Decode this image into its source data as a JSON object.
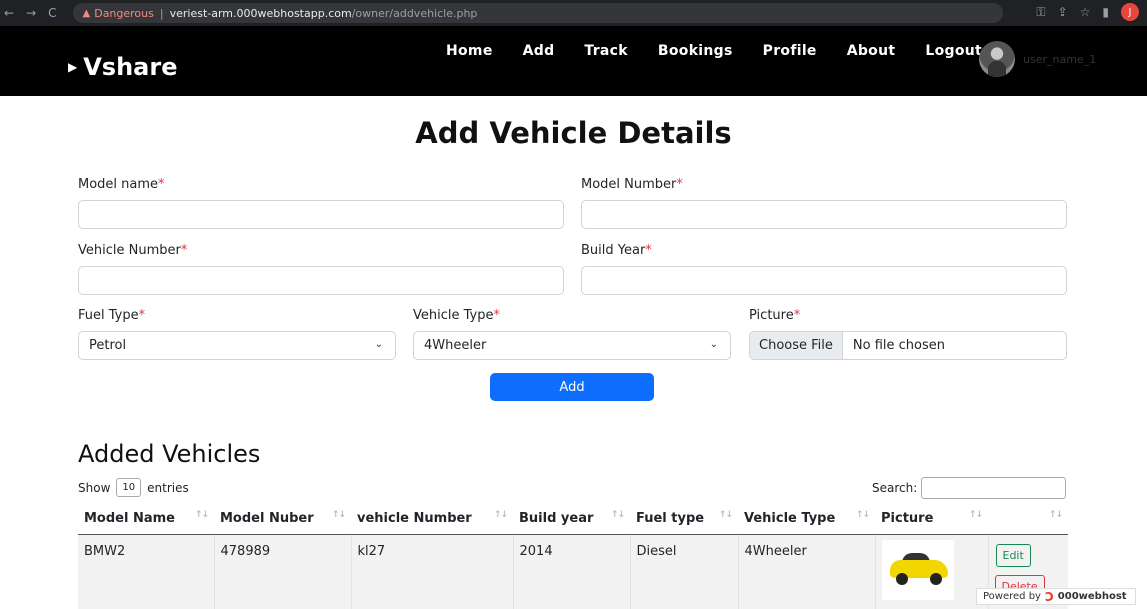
{
  "browser": {
    "nav_back": "←",
    "nav_forward": "→",
    "nav_reload": "C",
    "security_label": "Dangerous",
    "url_host": "veriest-arm.000webhostapp.com",
    "url_path": "/owner/addvehicle.php",
    "profile_initial": "J"
  },
  "navbar": {
    "brand": "Vshare",
    "items": [
      {
        "label": "Home"
      },
      {
        "label": "Add"
      },
      {
        "label": "Track"
      },
      {
        "label": "Bookings"
      },
      {
        "label": "Profile"
      },
      {
        "label": "About"
      },
      {
        "label": "Logout"
      }
    ],
    "username": "user_name_1"
  },
  "form": {
    "title": "Add Vehicle Details",
    "model_name_label": "Model name",
    "model_number_label": "Model Number",
    "vehicle_number_label": "Vehicle Number",
    "build_year_label": "Build Year",
    "fuel_type_label": "Fuel Type",
    "fuel_type_value": "Petrol",
    "vehicle_type_label": "Vehicle Type",
    "vehicle_type_value": "4Wheeler",
    "picture_label": "Picture",
    "choose_file": "Choose File",
    "no_file": "No file chosen",
    "required_mark": "*",
    "add_button": "Add"
  },
  "table": {
    "title": "Added Vehicles",
    "show_label": "Show",
    "entries_value": "10",
    "entries_label": "entries",
    "search_label": "Search:",
    "headers": [
      "Model Name",
      "Model Nuber",
      "vehicle Number",
      "Build year",
      "Fuel type",
      "Vehicle Type",
      "Picture",
      ""
    ],
    "rows": [
      {
        "model_name": "BMW2",
        "model_number": "478989",
        "vehicle_number": "kl27",
        "build_year": "2014",
        "fuel_type": "Diesel",
        "vehicle_type": "4Wheeler",
        "edit": "Edit",
        "delete": "Delete"
      }
    ]
  },
  "footer_badge": {
    "powered": "Powered by",
    "brand": "000webhost"
  }
}
